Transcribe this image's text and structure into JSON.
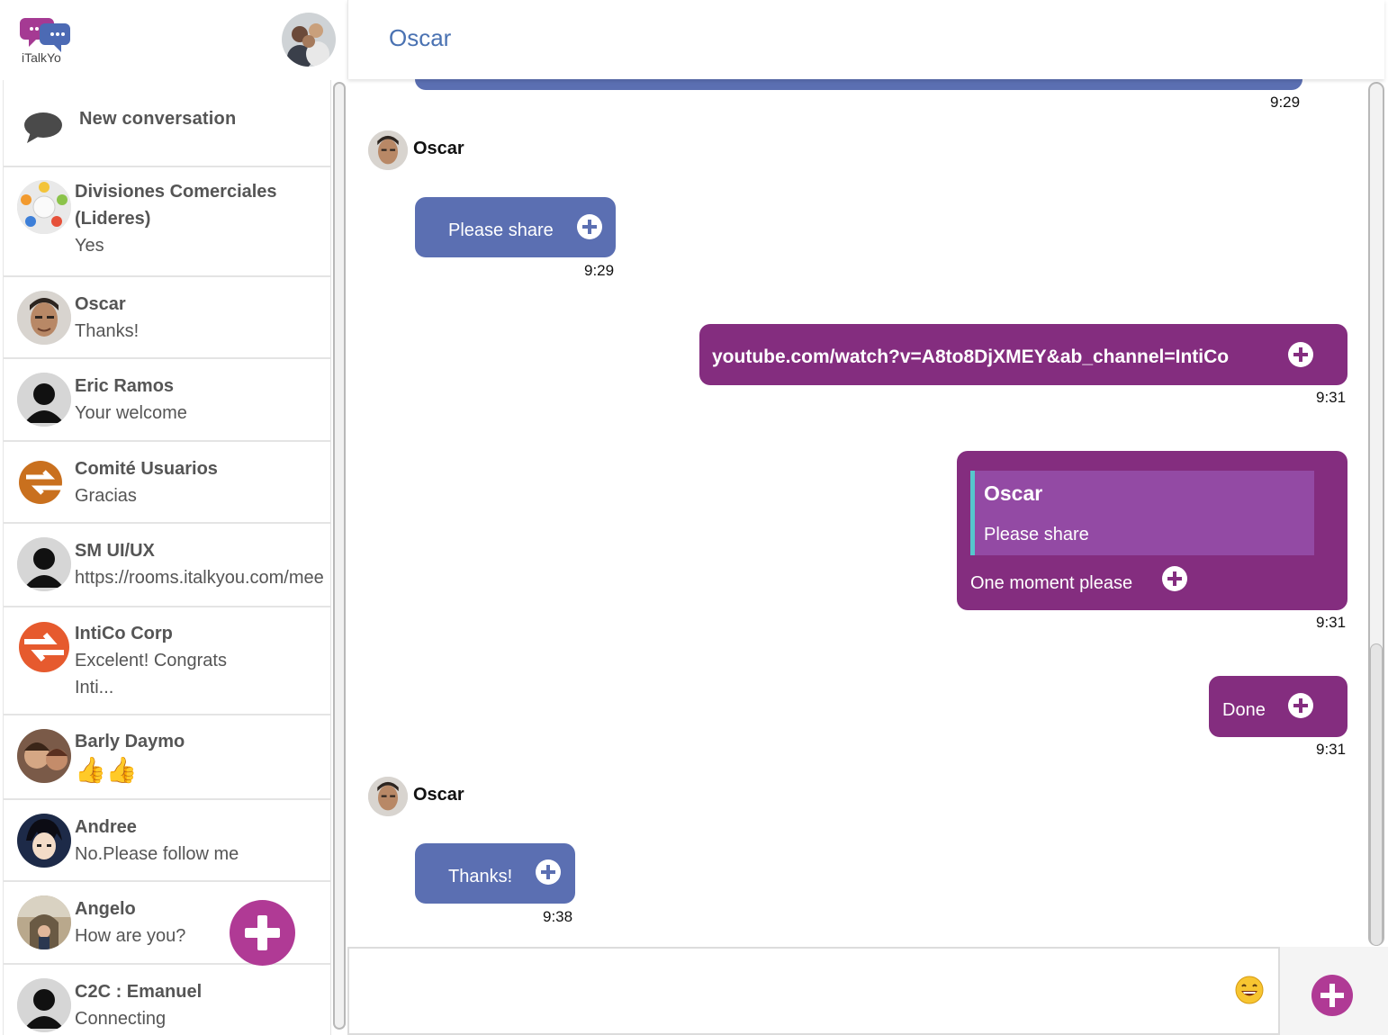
{
  "app": {
    "logo_text": "iTalkYo"
  },
  "header": {
    "title": "Oscar"
  },
  "sidebar": {
    "new_conversation_label": "New conversation",
    "conversations": [
      {
        "name": "Divisiones Comerciales (Lideres)",
        "preview": "Yes",
        "avatar": "group-divisions-avatar"
      },
      {
        "name": "Oscar",
        "preview": "Thanks!",
        "avatar": "oscar-avatar"
      },
      {
        "name": "Eric Ramos",
        "preview": "Your welcome",
        "avatar": "default-user-avatar"
      },
      {
        "name": "Comité Usuarios",
        "preview": "Gracias",
        "avatar": "intico-logo-avatar"
      },
      {
        "name": "SM UI/UX",
        "preview": "https://rooms.italkyou.com/mee",
        "avatar": "default-user-avatar"
      },
      {
        "name": "IntiCo Corp",
        "preview": "Excelent! Congrats Inti...",
        "avatar": "intico-logo-avatar"
      },
      {
        "name": "Barly Daymo",
        "preview": "👍👍",
        "avatar": "barly-avatar"
      },
      {
        "name": "Andree",
        "preview": "No.Please follow me",
        "avatar": "anime-avatar"
      },
      {
        "name": "Angelo",
        "preview": "How are you?",
        "avatar": "angelo-avatar"
      },
      {
        "name": "C2C : Emanuel",
        "preview": "Connecting",
        "avatar": "default-user-avatar"
      }
    ]
  },
  "messages": [
    {
      "direction": "incoming",
      "partial": true,
      "time": "9:29"
    },
    {
      "direction": "incoming",
      "sender": "Oscar",
      "text": "Please share",
      "time": "9:29"
    },
    {
      "direction": "outgoing",
      "text": "youtube.com/watch?v=A8to8DjXMEY&ab_channel=IntiCo",
      "time": "9:31"
    },
    {
      "direction": "outgoing",
      "quote": {
        "sender": "Oscar",
        "text": "Please share"
      },
      "text": "One moment please",
      "time": "9:31"
    },
    {
      "direction": "outgoing",
      "text": "Done",
      "time": "9:31"
    },
    {
      "direction": "incoming",
      "sender": "Oscar",
      "text": "Thanks!",
      "time": "9:38"
    }
  ],
  "composer": {
    "placeholder": "",
    "emoji": "😄"
  },
  "colors": {
    "incoming_bubble": "#5b6fb2",
    "outgoing_bubble": "#842d7f",
    "quote_background": "#934aa4",
    "quote_bar": "#55c7cc",
    "accent": "#b03a95",
    "title": "#4a72b2"
  }
}
